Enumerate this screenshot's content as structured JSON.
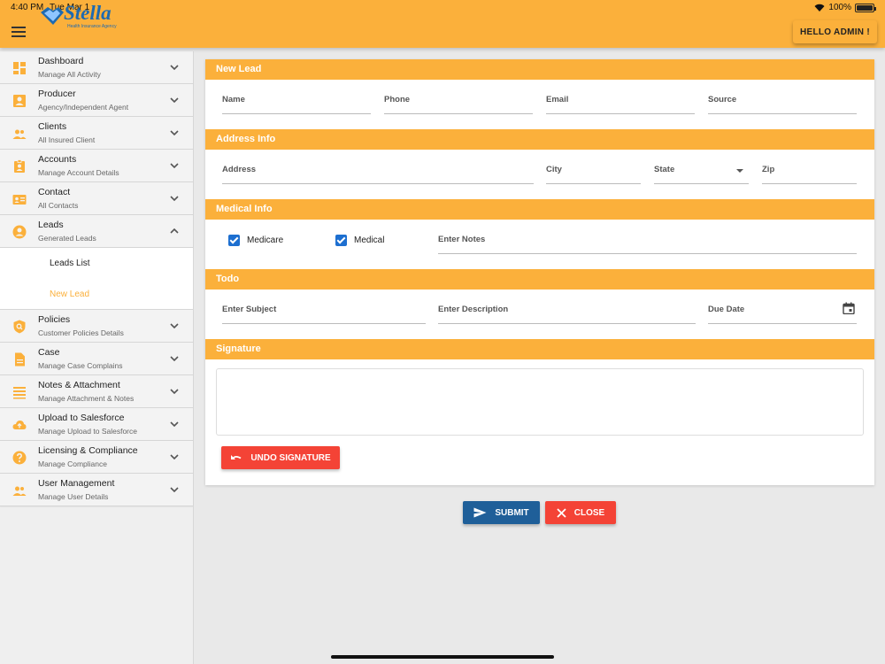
{
  "status_bar": {
    "time": "4:40 PM",
    "date": "Tue Mar 1",
    "battery": "100%",
    "battery_level": 1.0
  },
  "brand": {
    "name": "Stella",
    "tagline": "Health Insurance Agency",
    "color": "#1e6ab0"
  },
  "header": {
    "greeting_button": "HELLO ADMIN !",
    "accent_color": "#fbb03b"
  },
  "sidebar": {
    "items": [
      {
        "title": "Dashboard",
        "subtitle": "Manage All Activity",
        "icon": "dashboard-icon"
      },
      {
        "title": "Producer",
        "subtitle": "Agency/Independent Agent",
        "icon": "badge-icon"
      },
      {
        "title": "Clients",
        "subtitle": "All Insured Client",
        "icon": "people-icon"
      },
      {
        "title": "Accounts",
        "subtitle": "Manage Account Details",
        "icon": "account-box-icon"
      },
      {
        "title": "Contact",
        "subtitle": "All Contacts",
        "icon": "contact-card-icon"
      },
      {
        "title": "Leads",
        "subtitle": "Generated Leads",
        "icon": "account-circle-icon",
        "expanded": true
      },
      {
        "title": "Policies",
        "subtitle": "Customer Policies Details",
        "icon": "policy-shield-icon"
      },
      {
        "title": "Case",
        "subtitle": "Manage Case Complains",
        "icon": "document-icon"
      },
      {
        "title": "Notes & Attachment",
        "subtitle": "Manage Attachment & Notes",
        "icon": "notes-icon"
      },
      {
        "title": "Upload to Salesforce",
        "subtitle": "Manage Upload to Salesforce",
        "icon": "cloud-upload-icon"
      },
      {
        "title": "Licensing & Compliance",
        "subtitle": "Manage Compliance",
        "icon": "help-icon"
      },
      {
        "title": "User Management",
        "subtitle": "Manage User Details",
        "icon": "people-icon"
      }
    ],
    "leads_sub": [
      {
        "label": "Leads List",
        "active": false
      },
      {
        "label": "New Lead",
        "active": true
      }
    ]
  },
  "form": {
    "sections": {
      "new_lead": "New Lead",
      "address": "Address Info",
      "medical": "Medical Info",
      "todo": "Todo",
      "signature": "Signature"
    },
    "fields": {
      "name": "Name",
      "phone": "Phone",
      "email": "Email",
      "source": "Source",
      "address": "Address",
      "city": "City",
      "state": "State",
      "zip": "Zip",
      "notes": "Enter Notes",
      "subject": "Enter Subject",
      "description": "Enter Description",
      "due_date": "Due Date"
    },
    "checkboxes": {
      "medicare": {
        "label": "Medicare",
        "checked": true
      },
      "medical": {
        "label": "Medical",
        "checked": true
      }
    },
    "undo_signature": "UNDO SIGNATURE"
  },
  "actions": {
    "submit": "SUBMIT",
    "close": "CLOSE"
  }
}
